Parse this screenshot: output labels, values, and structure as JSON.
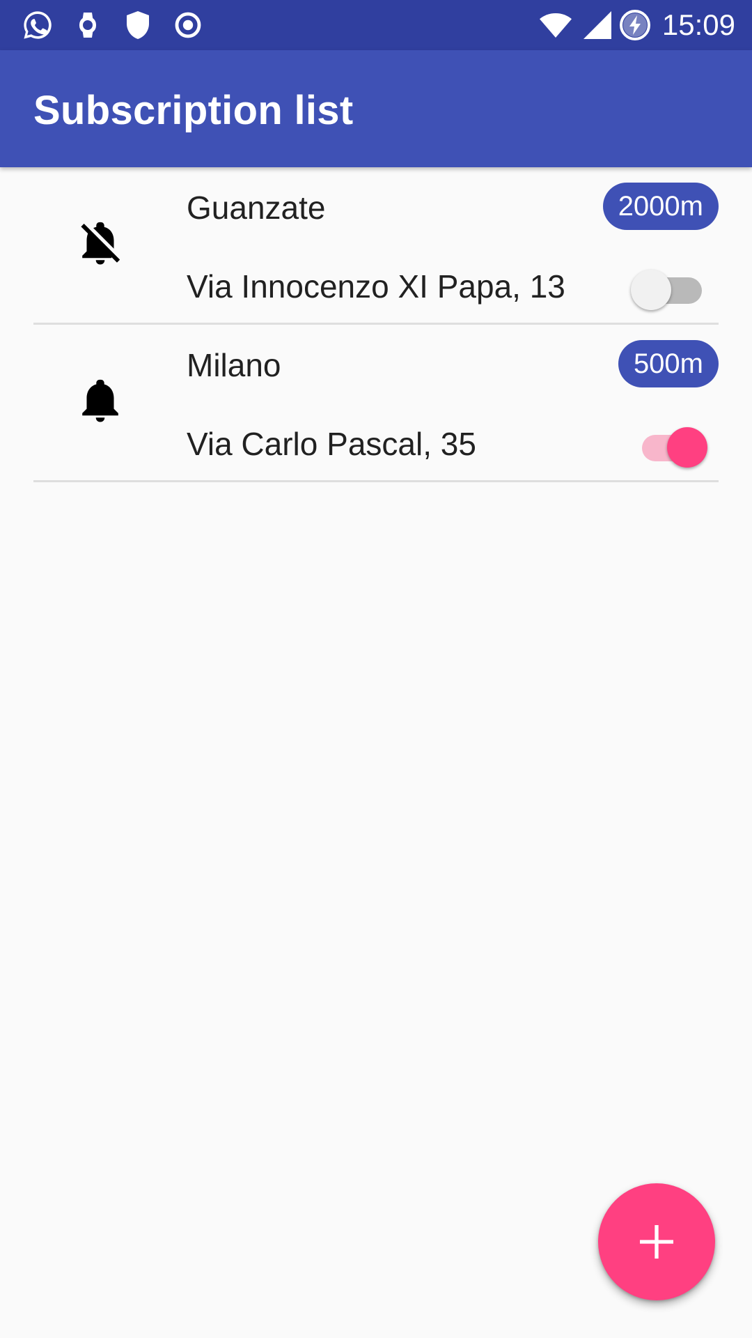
{
  "status_bar": {
    "time": "15:09",
    "left_icons": [
      "whatsapp-icon",
      "watch-icon",
      "shield-icon",
      "record-icon"
    ],
    "right_icons": [
      "wifi-icon",
      "signal-icon",
      "battery-charging-icon"
    ]
  },
  "app_bar": {
    "title": "Subscription list"
  },
  "subscriptions": [
    {
      "city": "Guanzate",
      "address": "Via Innocenzo XI Papa, 13",
      "radius": "2000m",
      "enabled": false,
      "icon": "bell-off-icon"
    },
    {
      "city": "Milano",
      "address": "Via Carlo Pascal, 35",
      "radius": "500m",
      "enabled": true,
      "icon": "bell-icon"
    }
  ],
  "fab": {
    "icon": "plus-icon"
  },
  "colors": {
    "primary": "#3f51b5",
    "primary_dark": "#303f9f",
    "accent": "#ff4081",
    "background": "#fafafa"
  }
}
